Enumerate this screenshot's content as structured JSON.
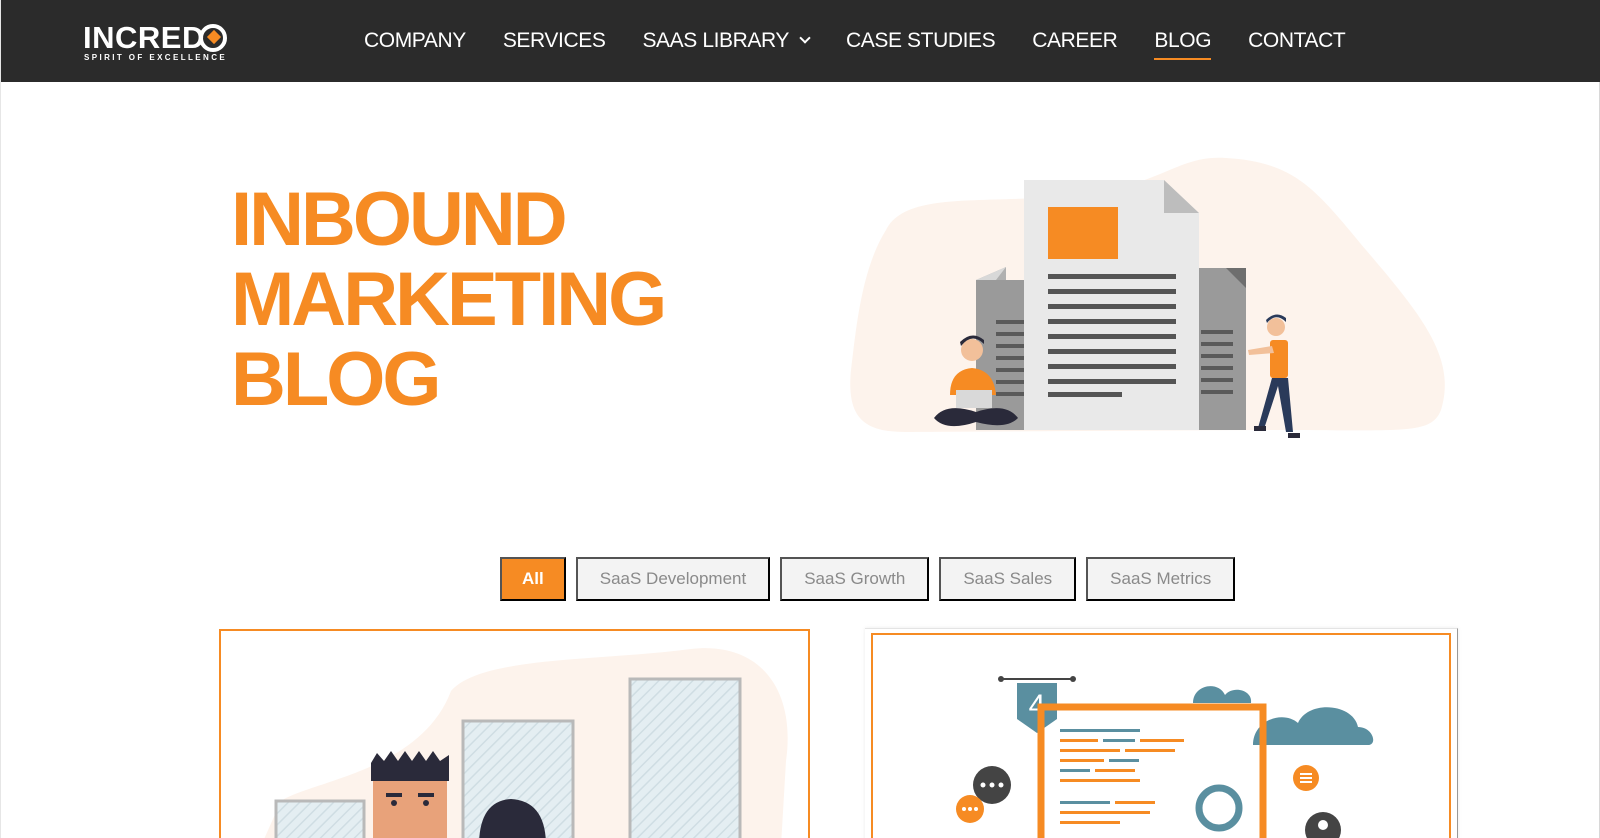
{
  "brand": {
    "name": "INCREDQ",
    "name_prefix": "INCRED",
    "tagline": "SPIRIT OF EXCELLENCE"
  },
  "nav": {
    "items": [
      {
        "label": "COMPANY",
        "active": false
      },
      {
        "label": "SERVICES",
        "active": false
      },
      {
        "label": "SAAS LIBRARY",
        "active": false,
        "has_dropdown": true
      },
      {
        "label": "CASE STUDIES",
        "active": false
      },
      {
        "label": "CAREER",
        "active": false
      },
      {
        "label": "BLOG",
        "active": true
      },
      {
        "label": "CONTACT",
        "active": false
      }
    ]
  },
  "hero": {
    "title_lines": [
      "INBOUND",
      "MARKETING",
      "BLOG"
    ]
  },
  "filters": {
    "items": [
      {
        "label": "All",
        "active": true
      },
      {
        "label": "SaaS Development",
        "active": false
      },
      {
        "label": "SaaS Growth",
        "active": false
      },
      {
        "label": "SaaS Sales",
        "active": false
      },
      {
        "label": "SaaS Metrics",
        "active": false
      }
    ]
  },
  "cards": {
    "card2_badge": "4"
  },
  "colors": {
    "accent": "#f68b23",
    "header_bg": "#2b2b2b",
    "teal": "#5a8fa0",
    "blob": "#fdf3ec"
  }
}
